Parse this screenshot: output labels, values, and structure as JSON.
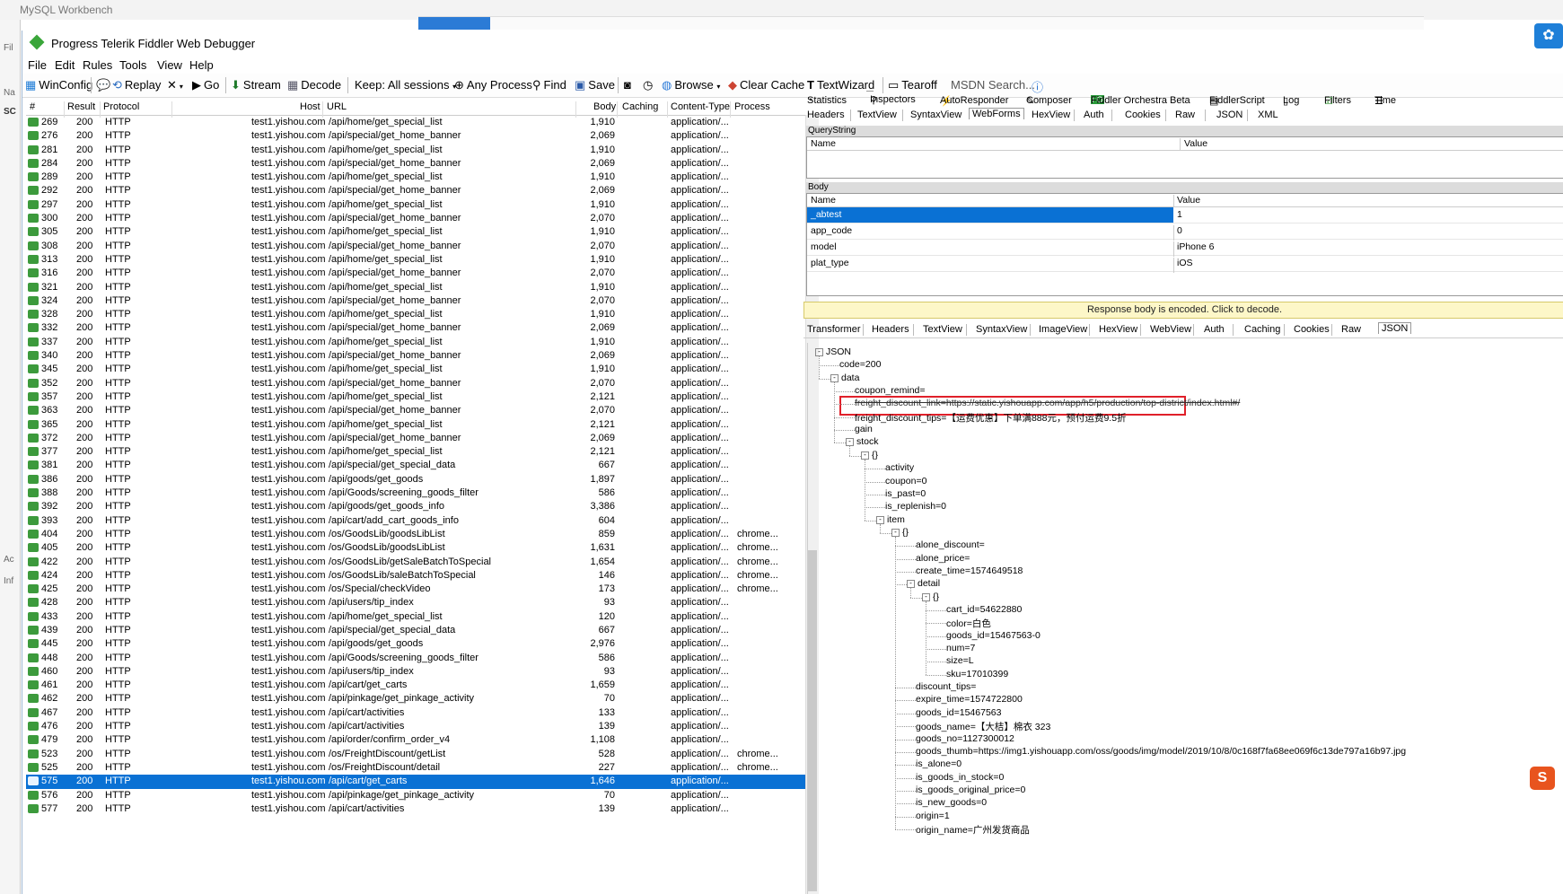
{
  "background": {
    "mysql_title": "MySQL Workbench",
    "left_labels": [
      "Fil",
      "Na",
      "SC",
      "Ac",
      "Inf"
    ]
  },
  "window": {
    "title": "Progress Telerik Fiddler Web Debugger"
  },
  "menu": [
    "File",
    "Edit",
    "Rules",
    "Tools",
    "View",
    "Help"
  ],
  "toolbar": {
    "winconfig": "WinConfig",
    "replay": "Replay",
    "go": "Go",
    "stream": "Stream",
    "decode": "Decode",
    "keep": "Keep: All sessions",
    "process": "Any Process",
    "find": "Find",
    "save": "Save",
    "browse": "Browse",
    "clear_cache": "Clear Cache",
    "textwizard": "TextWizard",
    "tearoff": "Tearoff",
    "msdn_search": "MSDN Search..."
  },
  "columns": {
    "num": "#",
    "result": "Result",
    "protocol": "Protocol",
    "host": "Host",
    "url": "URL",
    "body": "Body",
    "caching": "Caching",
    "content_type": "Content-Type",
    "process": "Process"
  },
  "sessions": [
    [
      "269",
      "200",
      "HTTP",
      "test1.yishou.com",
      "/api/home/get_special_list",
      "1,910",
      "application/...",
      ""
    ],
    [
      "276",
      "200",
      "HTTP",
      "test1.yishou.com",
      "/api/special/get_home_banner",
      "2,069",
      "application/...",
      ""
    ],
    [
      "281",
      "200",
      "HTTP",
      "test1.yishou.com",
      "/api/home/get_special_list",
      "1,910",
      "application/...",
      ""
    ],
    [
      "284",
      "200",
      "HTTP",
      "test1.yishou.com",
      "/api/special/get_home_banner",
      "2,069",
      "application/...",
      ""
    ],
    [
      "289",
      "200",
      "HTTP",
      "test1.yishou.com",
      "/api/home/get_special_list",
      "1,910",
      "application/...",
      ""
    ],
    [
      "292",
      "200",
      "HTTP",
      "test1.yishou.com",
      "/api/special/get_home_banner",
      "2,069",
      "application/...",
      ""
    ],
    [
      "297",
      "200",
      "HTTP",
      "test1.yishou.com",
      "/api/home/get_special_list",
      "1,910",
      "application/...",
      ""
    ],
    [
      "300",
      "200",
      "HTTP",
      "test1.yishou.com",
      "/api/special/get_home_banner",
      "2,070",
      "application/...",
      ""
    ],
    [
      "305",
      "200",
      "HTTP",
      "test1.yishou.com",
      "/api/home/get_special_list",
      "1,910",
      "application/...",
      ""
    ],
    [
      "308",
      "200",
      "HTTP",
      "test1.yishou.com",
      "/api/special/get_home_banner",
      "2,070",
      "application/...",
      ""
    ],
    [
      "313",
      "200",
      "HTTP",
      "test1.yishou.com",
      "/api/home/get_special_list",
      "1,910",
      "application/...",
      ""
    ],
    [
      "316",
      "200",
      "HTTP",
      "test1.yishou.com",
      "/api/special/get_home_banner",
      "2,070",
      "application/...",
      ""
    ],
    [
      "321",
      "200",
      "HTTP",
      "test1.yishou.com",
      "/api/home/get_special_list",
      "1,910",
      "application/...",
      ""
    ],
    [
      "324",
      "200",
      "HTTP",
      "test1.yishou.com",
      "/api/special/get_home_banner",
      "2,070",
      "application/...",
      ""
    ],
    [
      "328",
      "200",
      "HTTP",
      "test1.yishou.com",
      "/api/home/get_special_list",
      "1,910",
      "application/...",
      ""
    ],
    [
      "332",
      "200",
      "HTTP",
      "test1.yishou.com",
      "/api/special/get_home_banner",
      "2,069",
      "application/...",
      ""
    ],
    [
      "337",
      "200",
      "HTTP",
      "test1.yishou.com",
      "/api/home/get_special_list",
      "1,910",
      "application/...",
      ""
    ],
    [
      "340",
      "200",
      "HTTP",
      "test1.yishou.com",
      "/api/special/get_home_banner",
      "2,069",
      "application/...",
      ""
    ],
    [
      "345",
      "200",
      "HTTP",
      "test1.yishou.com",
      "/api/home/get_special_list",
      "1,910",
      "application/...",
      ""
    ],
    [
      "352",
      "200",
      "HTTP",
      "test1.yishou.com",
      "/api/special/get_home_banner",
      "2,070",
      "application/...",
      ""
    ],
    [
      "357",
      "200",
      "HTTP",
      "test1.yishou.com",
      "/api/home/get_special_list",
      "2,121",
      "application/...",
      ""
    ],
    [
      "363",
      "200",
      "HTTP",
      "test1.yishou.com",
      "/api/special/get_home_banner",
      "2,070",
      "application/...",
      ""
    ],
    [
      "365",
      "200",
      "HTTP",
      "test1.yishou.com",
      "/api/home/get_special_list",
      "2,121",
      "application/...",
      ""
    ],
    [
      "372",
      "200",
      "HTTP",
      "test1.yishou.com",
      "/api/special/get_home_banner",
      "2,069",
      "application/...",
      ""
    ],
    [
      "377",
      "200",
      "HTTP",
      "test1.yishou.com",
      "/api/home/get_special_list",
      "2,121",
      "application/...",
      ""
    ],
    [
      "381",
      "200",
      "HTTP",
      "test1.yishou.com",
      "/api/special/get_special_data",
      "667",
      "application/...",
      ""
    ],
    [
      "386",
      "200",
      "HTTP",
      "test1.yishou.com",
      "/api/goods/get_goods",
      "1,897",
      "application/...",
      ""
    ],
    [
      "388",
      "200",
      "HTTP",
      "test1.yishou.com",
      "/api/Goods/screening_goods_filter",
      "586",
      "application/...",
      ""
    ],
    [
      "392",
      "200",
      "HTTP",
      "test1.yishou.com",
      "/api/goods/get_goods_info",
      "3,386",
      "application/...",
      ""
    ],
    [
      "393",
      "200",
      "HTTP",
      "test1.yishou.com",
      "/api/cart/add_cart_goods_info",
      "604",
      "application/...",
      ""
    ],
    [
      "404",
      "200",
      "HTTP",
      "test1.yishou.com",
      "/os/GoodsLib/goodsLibList",
      "859",
      "application/...",
      "chrome..."
    ],
    [
      "405",
      "200",
      "HTTP",
      "test1.yishou.com",
      "/os/GoodsLib/goodsLibList",
      "1,631",
      "application/...",
      "chrome..."
    ],
    [
      "422",
      "200",
      "HTTP",
      "test1.yishou.com",
      "/os/GoodsLib/getSaleBatchToSpecial",
      "1,654",
      "application/...",
      "chrome..."
    ],
    [
      "424",
      "200",
      "HTTP",
      "test1.yishou.com",
      "/os/GoodsLib/saleBatchToSpecial",
      "146",
      "application/...",
      "chrome..."
    ],
    [
      "425",
      "200",
      "HTTP",
      "test1.yishou.com",
      "/os/Special/checkVideo",
      "173",
      "application/...",
      "chrome..."
    ],
    [
      "428",
      "200",
      "HTTP",
      "test1.yishou.com",
      "/api/users/tip_index",
      "93",
      "application/...",
      ""
    ],
    [
      "433",
      "200",
      "HTTP",
      "test1.yishou.com",
      "/api/home/get_special_list",
      "120",
      "application/...",
      ""
    ],
    [
      "439",
      "200",
      "HTTP",
      "test1.yishou.com",
      "/api/special/get_special_data",
      "667",
      "application/...",
      ""
    ],
    [
      "445",
      "200",
      "HTTP",
      "test1.yishou.com",
      "/api/goods/get_goods",
      "2,976",
      "application/...",
      ""
    ],
    [
      "448",
      "200",
      "HTTP",
      "test1.yishou.com",
      "/api/Goods/screening_goods_filter",
      "586",
      "application/...",
      ""
    ],
    [
      "460",
      "200",
      "HTTP",
      "test1.yishou.com",
      "/api/users/tip_index",
      "93",
      "application/...",
      ""
    ],
    [
      "461",
      "200",
      "HTTP",
      "test1.yishou.com",
      "/api/cart/get_carts",
      "1,659",
      "application/...",
      ""
    ],
    [
      "462",
      "200",
      "HTTP",
      "test1.yishou.com",
      "/api/pinkage/get_pinkage_activity",
      "70",
      "application/...",
      ""
    ],
    [
      "467",
      "200",
      "HTTP",
      "test1.yishou.com",
      "/api/cart/activities",
      "133",
      "application/...",
      ""
    ],
    [
      "476",
      "200",
      "HTTP",
      "test1.yishou.com",
      "/api/cart/activities",
      "139",
      "application/...",
      ""
    ],
    [
      "479",
      "200",
      "HTTP",
      "test1.yishou.com",
      "/api/order/confirm_order_v4",
      "1,108",
      "application/...",
      ""
    ],
    [
      "523",
      "200",
      "HTTP",
      "test1.yishou.com",
      "/os/FreightDiscount/getList",
      "528",
      "application/...",
      "chrome..."
    ],
    [
      "525",
      "200",
      "HTTP",
      "test1.yishou.com",
      "/os/FreightDiscount/detail",
      "227",
      "application/...",
      "chrome..."
    ],
    [
      "575",
      "200",
      "HTTP",
      "test1.yishou.com",
      "/api/cart/get_carts",
      "1,646",
      "application/...",
      ""
    ],
    [
      "576",
      "200",
      "HTTP",
      "test1.yishou.com",
      "/api/pinkage/get_pinkage_activity",
      "70",
      "application/...",
      ""
    ],
    [
      "577",
      "200",
      "HTTP",
      "test1.yishou.com",
      "/api/cart/activities",
      "139",
      "application/...",
      ""
    ]
  ],
  "selected_session": "575",
  "inspector_tabs": [
    "Statistics",
    "Inspectors",
    "AutoResponder",
    "Composer",
    "Fiddler Orchestra Beta",
    "FiddlerScript",
    "Log",
    "Filters",
    "Time"
  ],
  "active_inspector_tab": "Inspectors",
  "fo_badge": "FO",
  "request_tabs": [
    "Headers",
    "TextView",
    "SyntaxView",
    "WebForms",
    "HexView",
    "Auth",
    "Cookies",
    "Raw",
    "JSON",
    "XML"
  ],
  "active_request_tab": "WebForms",
  "querystring": {
    "title": "QueryString",
    "name_col": "Name",
    "value_col": "Value"
  },
  "body_section": {
    "title": "Body",
    "name_col": "Name",
    "value_col": "Value",
    "rows": [
      {
        "name": "_abtest",
        "value": "1"
      },
      {
        "name": "app_code",
        "value": "0"
      },
      {
        "name": "model",
        "value": "iPhone 6"
      },
      {
        "name": "plat_type",
        "value": "iOS"
      }
    ]
  },
  "decode_notice": "Response body is encoded. Click to decode.",
  "response_tabs": [
    "Transformer",
    "Headers",
    "TextView",
    "SyntaxView",
    "ImageView",
    "HexView",
    "WebView",
    "Auth",
    "Caching",
    "Cookies",
    "Raw",
    "JSON"
  ],
  "active_response_tab": "JSON",
  "json_tree": [
    {
      "d": 0,
      "t": "JSON",
      "tog": "-"
    },
    {
      "d": 1,
      "t": "code=200"
    },
    {
      "d": 1,
      "t": "data",
      "tog": "-"
    },
    {
      "d": 2,
      "t": "coupon_remind="
    },
    {
      "d": 2,
      "t": "freight_discount_link=https://static.yishouapp.com/app/h5/production/top-district/index.html#/",
      "strike": true
    },
    {
      "d": 2,
      "t": "freight_discount_tips=【运费优惠】下单满888元，预付运费9.5折"
    },
    {
      "d": 2,
      "t": "gain"
    },
    {
      "d": 2,
      "t": "stock",
      "tog": "-"
    },
    {
      "d": 3,
      "t": "{}",
      "tog": "-"
    },
    {
      "d": 4,
      "t": "activity"
    },
    {
      "d": 4,
      "t": "coupon=0"
    },
    {
      "d": 4,
      "t": "is_past=0"
    },
    {
      "d": 4,
      "t": "is_replenish=0"
    },
    {
      "d": 4,
      "t": "item",
      "tog": "-"
    },
    {
      "d": 5,
      "t": "{}",
      "tog": "-"
    },
    {
      "d": 6,
      "t": "alone_discount="
    },
    {
      "d": 6,
      "t": "alone_price="
    },
    {
      "d": 6,
      "t": "create_time=1574649518"
    },
    {
      "d": 6,
      "t": "detail",
      "tog": "-"
    },
    {
      "d": 7,
      "t": "{}",
      "tog": "-"
    },
    {
      "d": 8,
      "t": "cart_id=54622880"
    },
    {
      "d": 8,
      "t": "color=白色"
    },
    {
      "d": 8,
      "t": "goods_id=15467563-0"
    },
    {
      "d": 8,
      "t": "num=7"
    },
    {
      "d": 8,
      "t": "size=L"
    },
    {
      "d": 8,
      "t": "sku=17010399"
    },
    {
      "d": 6,
      "t": "discount_tips="
    },
    {
      "d": 6,
      "t": "expire_time=1574722800"
    },
    {
      "d": 6,
      "t": "goods_id=15467563"
    },
    {
      "d": 6,
      "t": "goods_name=【大桔】棉衣 323"
    },
    {
      "d": 6,
      "t": "goods_no=1127300012"
    },
    {
      "d": 6,
      "t": "goods_thumb=https://img1.yishouapp.com/oss/goods/img/model/2019/10/8/0c168f7fa68ee069f6c13de797a16b97.jpg"
    },
    {
      "d": 6,
      "t": "is_alone=0"
    },
    {
      "d": 6,
      "t": "is_goods_in_stock=0"
    },
    {
      "d": 6,
      "t": "is_goods_original_price=0"
    },
    {
      "d": 6,
      "t": "is_new_goods=0"
    },
    {
      "d": 6,
      "t": "origin=1"
    },
    {
      "d": 6,
      "t": "origin_name=广州发货商品"
    }
  ]
}
